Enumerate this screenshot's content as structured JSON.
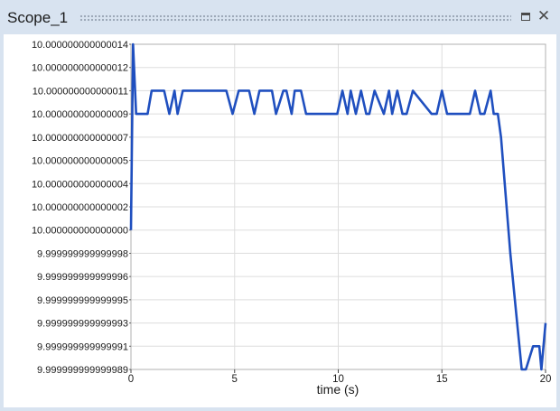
{
  "window": {
    "title": "Scope_1",
    "maximize_icon": "maximize-icon",
    "close_icon": "close-icon",
    "colors": {
      "background": "#d8e3f0",
      "plot_bg": "#ffffff",
      "line": "#1f4fbf",
      "grid": "#dddddd"
    }
  },
  "chart_data": {
    "type": "line",
    "title": "",
    "xlabel": "time (s)",
    "ylabel": "",
    "xlim": [
      0,
      20
    ],
    "ylim_labels_top_to_bottom": [
      "10.000000000000014",
      "10.000000000000012",
      "10.000000000000011",
      "10.000000000000009",
      "10.000000000000007",
      "10.000000000000005",
      "10.000000000000004",
      "10.000000000000002",
      "10.000000000000000",
      "9.999999999999998",
      "9.999999999999996",
      "9.999999999999995",
      "9.999999999999993",
      "9.999999999999991",
      "9.999999999999989"
    ],
    "x_ticks": [
      "0",
      "5",
      "10",
      "15",
      "20"
    ],
    "grid": true,
    "series": [
      {
        "color": "#1f4fbf",
        "x": [
          0,
          0.1,
          0.25,
          0.8,
          1.0,
          1.6,
          1.85,
          2.1,
          2.25,
          2.5,
          2.65,
          4.6,
          4.9,
          5.2,
          5.7,
          5.95,
          6.2,
          6.8,
          7.0,
          7.35,
          7.5,
          7.75,
          7.9,
          8.2,
          8.45,
          8.75,
          9.05,
          9.95,
          10.2,
          10.45,
          10.6,
          10.85,
          11.1,
          11.35,
          11.5,
          11.75,
          12.2,
          12.45,
          12.6,
          12.85,
          13.1,
          13.3,
          13.6,
          14.5,
          14.75,
          15.0,
          15.25,
          16.35,
          16.6,
          16.85,
          17.05,
          17.35,
          17.5,
          17.7,
          17.85,
          18.3,
          18.85,
          19.05,
          19.4,
          19.7,
          19.8,
          20.0
        ],
        "y": [
          10.0,
          10.000000000000014,
          10.000000000000009,
          10.000000000000009,
          10.00000000000001,
          10.00000000000001,
          10.000000000000009,
          10.00000000000001,
          10.000000000000009,
          10.00000000000001,
          10.00000000000001,
          10.00000000000001,
          10.000000000000009,
          10.00000000000001,
          10.00000000000001,
          10.000000000000009,
          10.00000000000001,
          10.00000000000001,
          10.000000000000009,
          10.00000000000001,
          10.00000000000001,
          10.000000000000009,
          10.00000000000001,
          10.00000000000001,
          10.000000000000009,
          10.000000000000009,
          10.000000000000009,
          10.000000000000009,
          10.00000000000001,
          10.000000000000009,
          10.00000000000001,
          10.000000000000009,
          10.00000000000001,
          10.000000000000009,
          10.000000000000009,
          10.00000000000001,
          10.000000000000009,
          10.00000000000001,
          10.000000000000009,
          10.00000000000001,
          10.000000000000009,
          10.000000000000009,
          10.00000000000001,
          10.000000000000009,
          10.000000000000009,
          10.00000000000001,
          10.000000000000009,
          10.000000000000009,
          10.00000000000001,
          10.000000000000009,
          10.000000000000009,
          10.00000000000001,
          10.000000000000009,
          10.000000000000009,
          10.000000000000007,
          9.999999999999998,
          9.99999999999999,
          9.99999999999999,
          9.999999999999991,
          9.999999999999991,
          9.99999999999999,
          9.999999999999993
        ]
      }
    ]
  }
}
